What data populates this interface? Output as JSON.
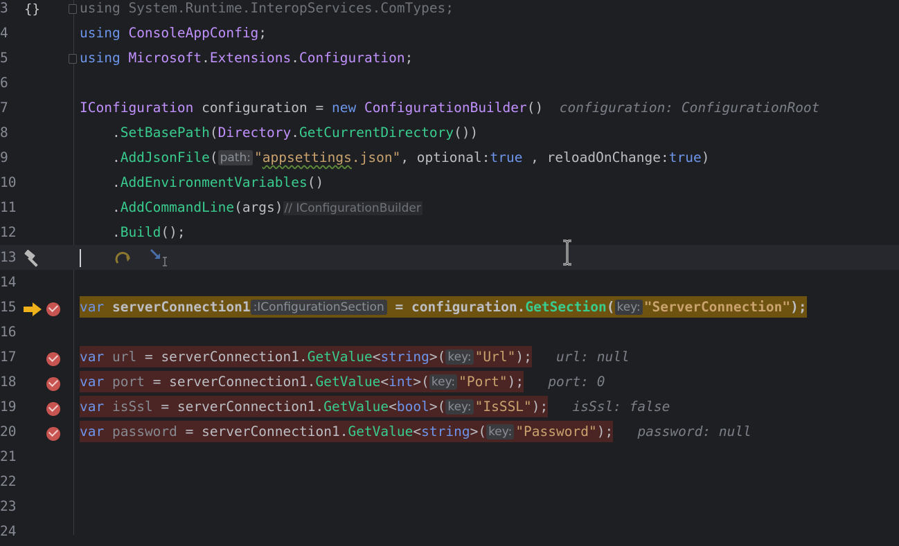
{
  "lines": [
    {
      "num": "3",
      "tokens": [
        {
          "t": "using System.Runtime.InteropServices.ComTypes;",
          "c": "t-ghost"
        }
      ]
    },
    {
      "num": "4",
      "tokens": [
        {
          "t": "using",
          "c": "t-kw"
        },
        {
          "t": " "
        },
        {
          "t": "ConsoleAppConfig",
          "c": "t-ns"
        },
        {
          "t": ";"
        }
      ]
    },
    {
      "num": "5",
      "tokens": [
        {
          "t": "using",
          "c": "t-kw"
        },
        {
          "t": " "
        },
        {
          "t": "Microsoft",
          "c": "t-ns"
        },
        {
          "t": "."
        },
        {
          "t": "Extensions",
          "c": "t-ns"
        },
        {
          "t": "."
        },
        {
          "t": "Configuration",
          "c": "t-ns"
        },
        {
          "t": ";"
        }
      ]
    },
    {
      "num": "6",
      "tokens": []
    },
    {
      "num": "7",
      "tokens": [
        {
          "t": "IConfiguration",
          "c": "t-type"
        },
        {
          "t": " configuration = "
        },
        {
          "t": "new",
          "c": "t-kw"
        },
        {
          "t": " "
        },
        {
          "t": "ConfigurationBuilder",
          "c": "t-type"
        },
        {
          "t": "()"
        },
        {
          "t": "  "
        },
        {
          "t": "configuration: ConfigurationRoot",
          "c": "inline-val"
        }
      ]
    },
    {
      "num": "8",
      "tokens": [
        {
          "t": "    ."
        },
        {
          "t": "SetBasePath",
          "c": "t-method"
        },
        {
          "t": "("
        },
        {
          "t": "Directory",
          "c": "t-type"
        },
        {
          "t": "."
        },
        {
          "t": "GetCurrentDirectory",
          "c": "t-method"
        },
        {
          "t": "())"
        }
      ]
    },
    {
      "num": "9",
      "tokens": [
        {
          "t": "    ."
        },
        {
          "t": "AddJsonFile",
          "c": "t-method"
        },
        {
          "t": "("
        },
        {
          "t": "path:",
          "c": "hint"
        },
        {
          "t": "\"",
          "c": "t-str"
        },
        {
          "t": "appsettings",
          "c": "t-str squiggle"
        },
        {
          "t": ".json\"",
          "c": "t-str"
        },
        {
          "t": ", optional:"
        },
        {
          "t": "true",
          "c": "t-kw"
        },
        {
          "t": " , reloadOnChange:"
        },
        {
          "t": "true",
          "c": "t-kw"
        },
        {
          "t": ")"
        }
      ]
    },
    {
      "num": "10",
      "tokens": [
        {
          "t": "    ."
        },
        {
          "t": "AddEnvironmentVariables",
          "c": "t-method"
        },
        {
          "t": "()"
        }
      ]
    },
    {
      "num": "11",
      "tokens": [
        {
          "t": "    ."
        },
        {
          "t": "AddCommandLine",
          "c": "t-method"
        },
        {
          "t": "(args)"
        },
        {
          "t": "// IConfigurationBuilder",
          "c": "comment-hint"
        }
      ]
    },
    {
      "num": "12",
      "tokens": [
        {
          "t": "    ."
        },
        {
          "t": "Build",
          "c": "t-method"
        },
        {
          "t": "();"
        }
      ]
    },
    {
      "num": "13",
      "tokens": []
    },
    {
      "num": "14",
      "tokens": []
    },
    {
      "num": "15",
      "tokens": [
        {
          "t": "var",
          "c": "t-kw"
        },
        {
          "t": " serverConnection1",
          "c": "bold"
        },
        {
          "t": ":IConfigurationSection",
          "c": "hint-type"
        },
        {
          "t": " = configuration.",
          "c": "bold"
        },
        {
          "t": "GetSection",
          "c": "t-method bold"
        },
        {
          "t": "(",
          "c": "bold"
        },
        {
          "t": "key:",
          "c": "hint"
        },
        {
          "t": "\"ServerConnection\"",
          "c": "t-str bold"
        },
        {
          "t": ");",
          "c": "bold"
        }
      ]
    },
    {
      "num": "16",
      "tokens": []
    },
    {
      "num": "17",
      "tokens": [
        {
          "t": "var",
          "c": "t-kw"
        },
        {
          "t": " "
        },
        {
          "t": "url",
          "c": "t-dim"
        },
        {
          "t": " = serverConnection1."
        },
        {
          "t": "GetValue",
          "c": "t-method"
        },
        {
          "t": "<"
        },
        {
          "t": "string",
          "c": "t-kw"
        },
        {
          "t": ">("
        },
        {
          "t": "key:",
          "c": "hint"
        },
        {
          "t": "\"Url\"",
          "c": "t-str"
        },
        {
          "t": ");"
        }
      ],
      "inline": "url: null"
    },
    {
      "num": "18",
      "tokens": [
        {
          "t": "var",
          "c": "t-kw"
        },
        {
          "t": " "
        },
        {
          "t": "port",
          "c": "t-dim"
        },
        {
          "t": " = serverConnection1."
        },
        {
          "t": "GetValue",
          "c": "t-method"
        },
        {
          "t": "<"
        },
        {
          "t": "int",
          "c": "t-kw"
        },
        {
          "t": ">("
        },
        {
          "t": "key:",
          "c": "hint"
        },
        {
          "t": "\"Port\"",
          "c": "t-str"
        },
        {
          "t": ");"
        }
      ],
      "inline": "port: 0"
    },
    {
      "num": "19",
      "tokens": [
        {
          "t": "var",
          "c": "t-kw"
        },
        {
          "t": " "
        },
        {
          "t": "isSsl",
          "c": "t-dim"
        },
        {
          "t": " = serverConnection1."
        },
        {
          "t": "GetValue",
          "c": "t-method"
        },
        {
          "t": "<"
        },
        {
          "t": "bool",
          "c": "t-kw"
        },
        {
          "t": ">("
        },
        {
          "t": "key:",
          "c": "hint"
        },
        {
          "t": "\"IsSSL\"",
          "c": "t-str"
        },
        {
          "t": ");"
        }
      ],
      "inline": "isSsl: false"
    },
    {
      "num": "20",
      "tokens": [
        {
          "t": "var",
          "c": "t-kw"
        },
        {
          "t": " "
        },
        {
          "t": "password",
          "c": "t-dim"
        },
        {
          "t": " = serverConnection1."
        },
        {
          "t": "GetValue",
          "c": "t-method"
        },
        {
          "t": "<"
        },
        {
          "t": "string",
          "c": "t-kw"
        },
        {
          "t": ">("
        },
        {
          "t": "key:",
          "c": "hint"
        },
        {
          "t": "\"Password\"",
          "c": "t-str"
        },
        {
          "t": ");"
        }
      ],
      "inline": "password: null"
    },
    {
      "num": "21",
      "tokens": []
    },
    {
      "num": "22",
      "tokens": []
    },
    {
      "num": "23",
      "tokens": []
    },
    {
      "num": "24",
      "tokens": []
    }
  ],
  "gutter": {
    "braces_glyph": "{}",
    "breakpoints": [
      "15",
      "17",
      "18",
      "19",
      "20"
    ],
    "execution_line": "15",
    "tool_line": "13"
  },
  "icons": {
    "structure": "braces-icon",
    "hammer": "hammer-icon",
    "execution": "execution-arrow-icon",
    "breakpoint": "breakpoint-icon",
    "cursor": "text-cursor-icon"
  },
  "colors": {
    "background": "#1e1f22",
    "breakpoint_line": "#4b2424",
    "execution_line": "#6d5210",
    "keyword": "#6c95eb",
    "type": "#c191ff",
    "method": "#39cc8f",
    "string": "#c9a26d"
  }
}
